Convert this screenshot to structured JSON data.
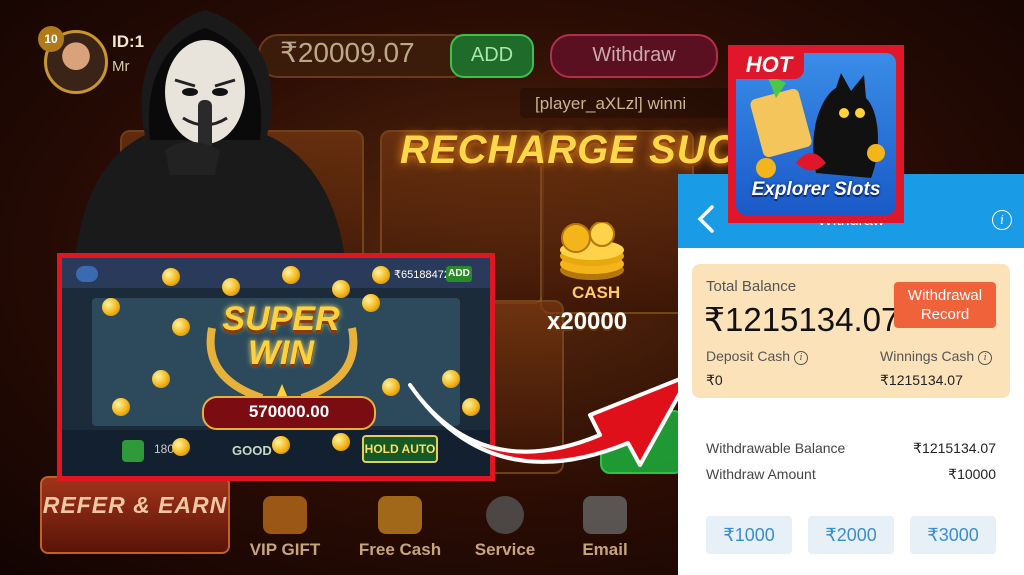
{
  "game": {
    "player_id": "ID:1",
    "player_name": "Mr",
    "level": "10",
    "balance": "₹20009.07",
    "add_label": "ADD",
    "withdraw_label": "Withdraw",
    "ticker": "[player_aXLzl] winni",
    "recharge_text": "RECHARGE SUCC",
    "cash_label": "CASH",
    "cash_amount": "x20000",
    "refer_label": "REFER & EARN",
    "nav": [
      "VIP GIFT",
      "Free Cash",
      "Service",
      "Email"
    ]
  },
  "superwin": {
    "title_line1": "SUPER",
    "title_line2": "WIN",
    "amount": "570000.00",
    "ticker": "₹65188472",
    "add_label": "ADD",
    "good_label": "GOOD",
    "hold_auto_label": "HOLD AUTO",
    "total_label": "180"
  },
  "hot_icon": {
    "tag": "HOT",
    "name": "Explorer Slots"
  },
  "withdraw_panel": {
    "title": "Withdraw",
    "total_balance_label": "Total Balance",
    "total_balance": "₹1215134.07",
    "withdrawal_record_label": "Withdrawal Record",
    "deposit_cash_label": "Deposit Cash",
    "deposit_cash": "₹0",
    "winnings_cash_label": "Winnings Cash",
    "winnings_cash": "₹1215134.07",
    "withdrawable_balance_label": "Withdrawable Balance",
    "withdrawable_balance": "₹1215134.07",
    "withdraw_amount_label": "Withdraw Amount",
    "withdraw_amount": "₹10000",
    "amount_options": [
      "₹1000",
      "₹2000",
      "₹3000"
    ]
  },
  "colors": {
    "accent_red": "#e0162a",
    "header_blue": "#1a9be6",
    "card_bg": "#fbe2b8",
    "record_btn": "#f0633a"
  }
}
